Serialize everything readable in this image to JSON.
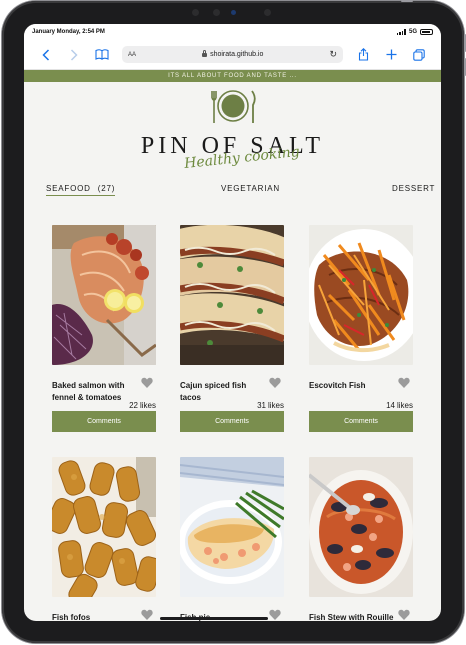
{
  "status": {
    "time": "January Monday, 2:54 PM",
    "network": "5G"
  },
  "browser": {
    "text_size_label": "AA",
    "url": "shoirata.github.io"
  },
  "banner": "ITS ALL ABOUT FOOD AND TASTE ...",
  "brand": {
    "name": "PIN OF SALT",
    "tagline": "Healthy cooking"
  },
  "categories": {
    "seafood": "SEAFOOD",
    "seafood_count": "(27)",
    "vegetarian": "VEGETARIAN",
    "dessert": "DESSERT"
  },
  "recipes": [
    {
      "title": "Baked salmon with fennel & tomatoes",
      "likes": "22",
      "likes_label": "likes",
      "button": "Comments"
    },
    {
      "title": "Cajun spiced fish tacos",
      "likes": "31",
      "likes_label": "likes",
      "button": "Comments"
    },
    {
      "title": "Escovitch Fish",
      "likes": "14",
      "likes_label": "likes",
      "button": "Comments"
    },
    {
      "title": "Fish fofos"
    },
    {
      "title": "Fish pie"
    },
    {
      "title": "Fish Stew with Rouille"
    }
  ],
  "colors": {
    "accent": "#7a8e4e",
    "background": "#f4f4f2",
    "link": "#1a73e8"
  }
}
